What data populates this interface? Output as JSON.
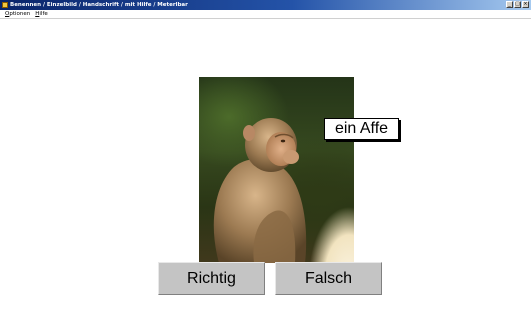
{
  "window": {
    "title": "Benennen / Einzelbild / Handschrift / mit Hilfe / Meterlbar",
    "buttons": [
      "minimize",
      "maximize",
      "close"
    ]
  },
  "menu": {
    "items": [
      {
        "underline": "O",
        "rest": "ptionen"
      },
      {
        "underline": "H",
        "rest": "ilfe"
      }
    ]
  },
  "picture": {
    "subject": "monkey photo",
    "label": "ein Affe"
  },
  "answers": {
    "correct_label": "Richtig",
    "wrong_label": "Falsch"
  },
  "colors": {
    "titlebar_start": "#0a246a",
    "titlebar_end": "#a6caf0",
    "button_face": "#c4c4c4",
    "background": "#ffffff"
  }
}
